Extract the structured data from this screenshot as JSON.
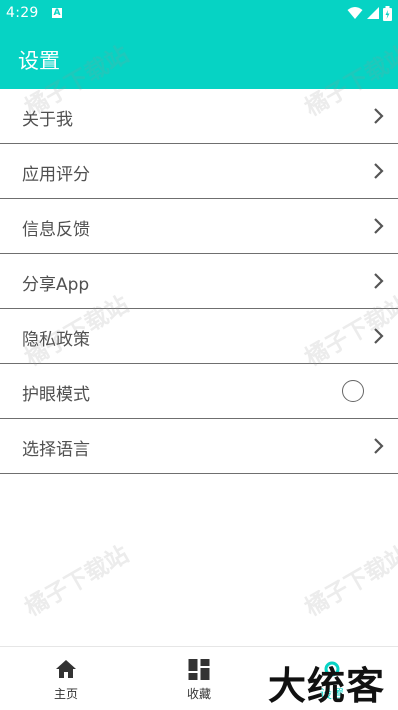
{
  "status_bar": {
    "time": "4:29",
    "a_badge": "A"
  },
  "app_bar": {
    "title": "设置"
  },
  "settings": {
    "items": [
      {
        "label": "关于我",
        "control": "chevron"
      },
      {
        "label": "应用评分",
        "control": "chevron"
      },
      {
        "label": "信息反馈",
        "control": "chevron"
      },
      {
        "label": "分享App",
        "control": "chevron"
      },
      {
        "label": "隐私政策",
        "control": "chevron"
      },
      {
        "label": "护眼模式",
        "control": "radio",
        "checked": false
      },
      {
        "label": "选择语言",
        "control": "chevron"
      }
    ]
  },
  "bottom_nav": {
    "items": [
      {
        "label": "主页",
        "icon": "home-icon",
        "active": false
      },
      {
        "label": "收藏",
        "icon": "dashboard-icon",
        "active": false
      },
      {
        "label": "设置",
        "icon": "settings-icon",
        "active": true
      }
    ]
  },
  "overlay": {
    "watermark_text": "橘子下载站",
    "brand_stamp": "大统客"
  },
  "colors": {
    "accent": "#06d3c4",
    "divider": "#6f6f6f",
    "text": "#505050"
  }
}
